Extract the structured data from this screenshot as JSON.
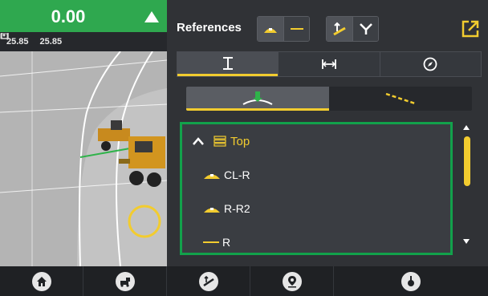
{
  "grade": {
    "value": "0.00",
    "arrow_icon": "triangle-up-icon",
    "left_dim": "25.85",
    "right_dim": "25.85"
  },
  "header": {
    "title": "References",
    "export_icon": "external-link-icon"
  },
  "tabs": [
    {
      "icon": "vertical-height-icon",
      "active": true
    },
    {
      "icon": "horizontal-width-icon",
      "active": false
    },
    {
      "icon": "compass-icon",
      "active": false
    }
  ],
  "mode_toggle": [
    {
      "icon": "surface-target-icon",
      "active": true
    },
    {
      "icon": "dashed-line-icon",
      "active": false
    }
  ],
  "reference_list": {
    "group": {
      "label": "Top",
      "expanded": true
    },
    "items": [
      {
        "label": "CL-R",
        "icon": "road-surface-icon"
      },
      {
        "label": "R-R2",
        "icon": "road-surface-icon"
      },
      {
        "label": "R",
        "icon": "line-icon"
      }
    ]
  },
  "toolbar": [
    {
      "icon": "home-icon"
    },
    {
      "icon": "machine-icon"
    },
    {
      "icon": "grade-control-icon"
    },
    {
      "icon": "location-pin-icon"
    },
    {
      "icon": "settings-dial-icon"
    }
  ],
  "colors": {
    "accent": "#f2cc2f",
    "grade_green": "#2fa84f",
    "list_border": "#12a14b"
  }
}
